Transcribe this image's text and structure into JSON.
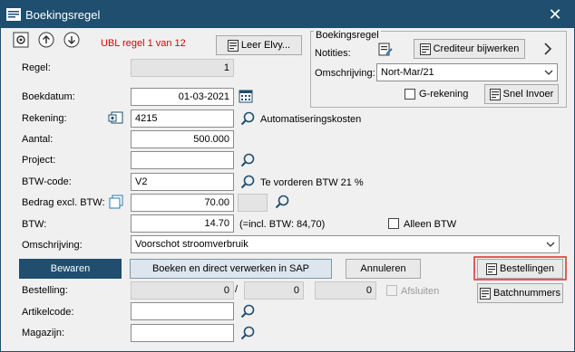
{
  "window": {
    "title": "Boekingsregel",
    "close_icon": "close-icon"
  },
  "toolbar": {
    "ubl_status": "UBL regel 1 van 12",
    "leer_label": "Leer Elvy...",
    "status_color": "#e00000"
  },
  "group": {
    "title": "Boekingsregel",
    "notities_label": "Notities:",
    "crediteur_label": "Crediteur bijwerken",
    "omschrijving_label": "Omschrijving:",
    "omschrijving_value": "Nort-Mar/21",
    "g_rekening_label": "G-rekening",
    "snel_invoer_label": "Snel Invoer"
  },
  "form": {
    "regel_label": "Regel:",
    "regel_value": "1",
    "boekdatum_label": "Boekdatum:",
    "boekdatum_value": "01-03-2021",
    "rekening_label": "Rekening:",
    "rekening_value": "4215",
    "rekening_desc": "Automatiseringskosten",
    "aantal_label": "Aantal:",
    "aantal_value": "500.000",
    "project_label": "Project:",
    "project_value": "",
    "btw_code_label": "BTW-code:",
    "btw_code_value": "V2",
    "btw_code_desc": "Te vorderen BTW 21 %",
    "bedrag_label": "Bedrag excl. BTW:",
    "bedrag_value": "70.00",
    "btw_label": "BTW:",
    "btw_value": "14.70",
    "btw_incl": "(=incl. BTW: 84,70)",
    "alleen_btw_label": "Alleen BTW",
    "omschrijving_label": "Omschrijving:",
    "omschrijving_value": "Voorschot stroomverbruik",
    "bestelling_label": "Bestelling:",
    "bestelling_val1": "0",
    "bestelling_sep": "/",
    "bestelling_val2": "0",
    "bestelling_val3": "0",
    "afsluiten_label": "Afsluiten",
    "artikelcode_label": "Artikelcode:",
    "magazijn_label": "Magazijn:"
  },
  "actions": {
    "bewaren": "Bewaren",
    "boeken": "Boeken en direct verwerken in SAP",
    "annuleren": "Annuleren",
    "bestellingen": "Bestellingen",
    "batchnummers": "Batchnummers"
  },
  "colors": {
    "title_bar": "#1f4e6e",
    "primary_button": "#1f4e6e",
    "highlight": "#e35a5a"
  }
}
